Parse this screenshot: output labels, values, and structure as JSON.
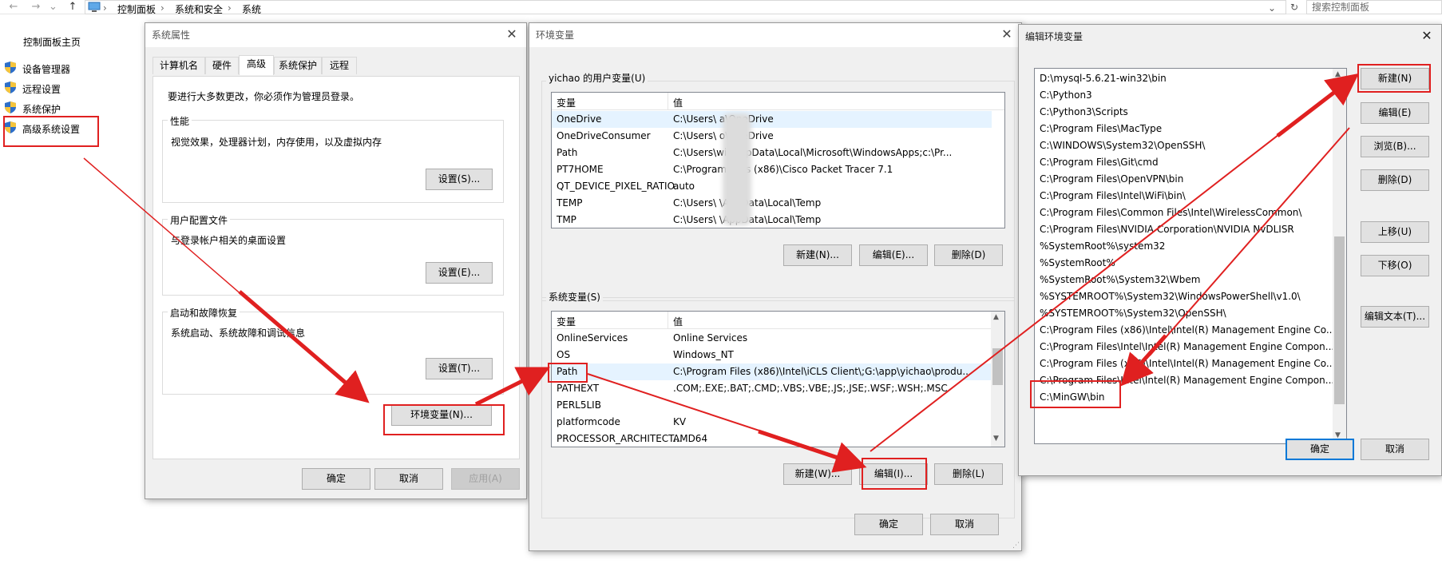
{
  "address_bar": {
    "back_icon": "←",
    "forward_icon": "→",
    "up_icon": "↑",
    "crumbs": [
      "控制面板",
      "系统和安全",
      "系统"
    ],
    "search_placeholder": "搜索控制面板"
  },
  "left_pane": {
    "home": "控制面板主页",
    "items": [
      "设备管理器",
      "远程设置",
      "系统保护",
      "高级系统设置"
    ]
  },
  "sysprops": {
    "title": "系统属性",
    "tabs": [
      "计算机名",
      "硬件",
      "高级",
      "系统保护",
      "远程"
    ],
    "admin_note": "要进行大多数更改，你必须作为管理员登录。",
    "perf_label": "性能",
    "perf_desc": "视觉效果，处理器计划，内存使用，以及虚拟内存",
    "perf_btn": "设置(S)...",
    "profile_label": "用户配置文件",
    "profile_desc": "与登录帐户相关的桌面设置",
    "profile_btn": "设置(E)...",
    "startup_label": "启动和故障恢复",
    "startup_desc": "系统启动、系统故障和调试信息",
    "startup_btn": "设置(T)...",
    "envvar_btn": "环境变量(N)...",
    "ok": "确定",
    "cancel": "取消",
    "apply": "应用(A)"
  },
  "envvars": {
    "title": "环境变量",
    "user_group": "yichao 的用户变量(U)",
    "col_var": "变量",
    "col_val": "值",
    "user_rows": [
      {
        "name": "OneDrive",
        "value": "C:\\Users\\     a\\OneDrive"
      },
      {
        "name": "OneDriveConsumer",
        "value": "C:\\Users\\     o\\OneDrive"
      },
      {
        "name": "Path",
        "value": "C:\\Users\\wi    \\AppData\\Local\\Microsoft\\WindowsApps;c:\\Pr..."
      },
      {
        "name": "PT7HOME",
        "value": "C:\\Program Files (x86)\\Cisco Packet Tracer 7.1"
      },
      {
        "name": "QT_DEVICE_PIXEL_RATIO",
        "value": "auto"
      },
      {
        "name": "TEMP",
        "value": "C:\\Users\\      \\AppData\\Local\\Temp"
      },
      {
        "name": "TMP",
        "value": "C:\\Users\\      \\AppData\\Local\\Temp"
      }
    ],
    "user_new": "新建(N)...",
    "user_edit": "编辑(E)...",
    "user_delete": "删除(D)",
    "sys_group": "系统变量(S)",
    "sys_rows": [
      {
        "name": "OnlineServices",
        "value": "Online Services"
      },
      {
        "name": "OS",
        "value": "Windows_NT"
      },
      {
        "name": "Path",
        "value": "C:\\Program Files (x86)\\Intel\\iCLS Client\\;G:\\app\\yichao\\produ..."
      },
      {
        "name": "PATHEXT",
        "value": ".COM;.EXE;.BAT;.CMD;.VBS;.VBE;.JS;.JSE;.WSF;.WSH;.MSC"
      },
      {
        "name": "PERL5LIB",
        "value": ""
      },
      {
        "name": "platformcode",
        "value": "KV"
      },
      {
        "name": "PROCESSOR_ARCHITECT...",
        "value": "AMD64"
      }
    ],
    "sys_new": "新建(W)...",
    "sys_edit": "编辑(I)...",
    "sys_delete": "删除(L)",
    "ok": "确定",
    "cancel": "取消"
  },
  "editenv": {
    "title": "编辑环境变量",
    "paths": [
      "D:\\mysql-5.6.21-win32\\bin",
      "C:\\Python3",
      "C:\\Python3\\Scripts",
      "C:\\Program Files\\MacType",
      "C:\\WINDOWS\\System32\\OpenSSH\\",
      "C:\\Program Files\\Git\\cmd",
      "C:\\Program Files\\OpenVPN\\bin",
      "C:\\Program Files\\Intel\\WiFi\\bin\\",
      "C:\\Program Files\\Common Files\\Intel\\WirelessCommon\\",
      "C:\\Program Files\\NVIDIA Corporation\\NVIDIA NvDLISR",
      "%SystemRoot%\\system32",
      "%SystemRoot%",
      "%SystemRoot%\\System32\\Wbem",
      "%SYSTEMROOT%\\System32\\WindowsPowerShell\\v1.0\\",
      "%SYSTEMROOT%\\System32\\OpenSSH\\",
      "C:\\Program Files (x86)\\Intel\\Intel(R) Management Engine Co...",
      "C:\\Program Files\\Intel\\Intel(R) Management Engine Compon...",
      "C:\\Program Files (x86)\\Intel\\Intel(R) Management Engine Co...",
      "C:\\Program Files\\Intel\\Intel(R) Management Engine Compon...",
      "C:\\MinGW\\bin"
    ],
    "new": "新建(N)",
    "edit": "编辑(E)",
    "browse": "浏览(B)...",
    "delete": "删除(D)",
    "up": "上移(U)",
    "down": "下移(O)",
    "edit_text": "编辑文本(T)...",
    "ok": "确定",
    "cancel": "取消"
  },
  "colors": {
    "annotation_red": "#e02020",
    "focus_blue": "#0078d7",
    "dialog_bg": "#f0f0f0"
  }
}
